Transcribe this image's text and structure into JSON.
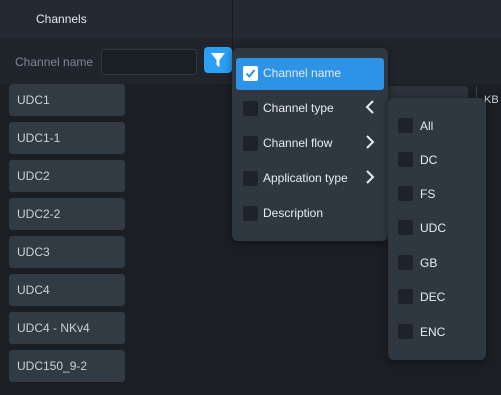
{
  "header": {
    "title": "Channels"
  },
  "filter": {
    "label": "Channel name",
    "input_value": "",
    "button_icon": "funnel-icon"
  },
  "channels": [
    "UDC1",
    "UDC1-1",
    "UDC2",
    "UDC2-2",
    "UDC3",
    "UDC4",
    "UDC4 - NKv4",
    "UDC150_9-2"
  ],
  "background": {
    "column_label_partial": "KB"
  },
  "filter_menu": {
    "items": [
      {
        "label": "Channel name",
        "checked": true,
        "selected": true,
        "arrow": ""
      },
      {
        "label": "Channel type",
        "checked": false,
        "selected": false,
        "arrow": "left"
      },
      {
        "label": "Channel flow",
        "checked": false,
        "selected": false,
        "arrow": "right"
      },
      {
        "label": "Application type",
        "checked": false,
        "selected": false,
        "arrow": "right"
      },
      {
        "label": "Description",
        "checked": false,
        "selected": false,
        "arrow": ""
      }
    ]
  },
  "channel_type_submenu": {
    "items": [
      {
        "label": "All",
        "checked": false
      },
      {
        "label": "DC",
        "checked": false
      },
      {
        "label": "FS",
        "checked": false
      },
      {
        "label": "UDC",
        "checked": false
      },
      {
        "label": "GB",
        "checked": false
      },
      {
        "label": "DEC",
        "checked": false
      },
      {
        "label": "ENC",
        "checked": false
      }
    ]
  },
  "colors": {
    "accent": "#2c93e7",
    "panel": "#2f3741",
    "background": "#1b1f24"
  }
}
